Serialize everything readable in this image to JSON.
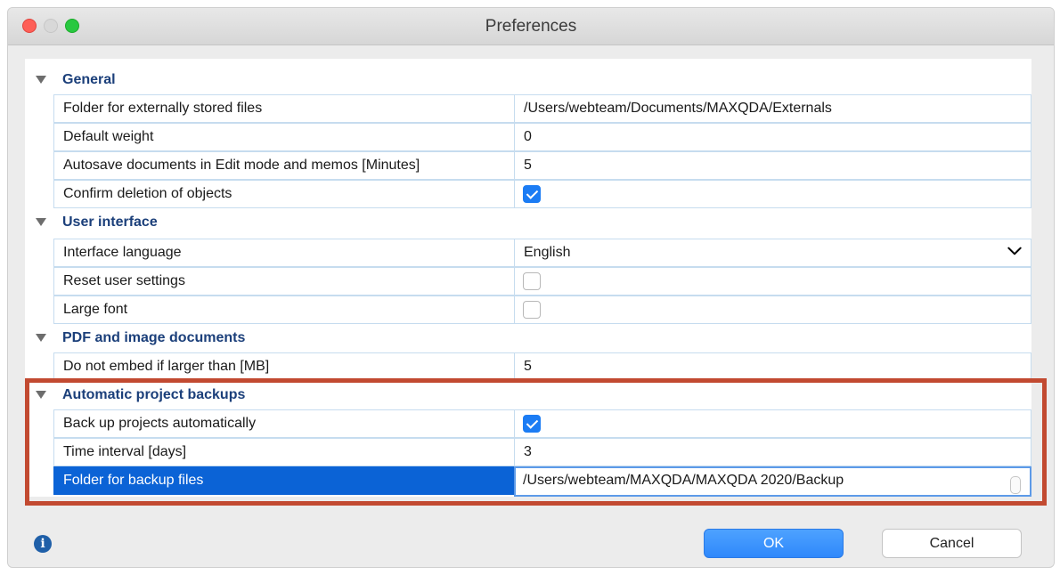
{
  "window": {
    "title": "Preferences"
  },
  "sections": {
    "general": {
      "label": "General",
      "rows": [
        {
          "label": "Folder for externally stored files",
          "value": "/Users/webteam/Documents/MAXQDA/Externals"
        },
        {
          "label": "Default weight",
          "value": "0"
        },
        {
          "label": "Autosave documents in Edit mode and memos [Minutes]",
          "value": "5"
        },
        {
          "label": "Confirm deletion of objects",
          "checked": true
        }
      ]
    },
    "ui": {
      "label": "User interface",
      "rows": [
        {
          "label": "Interface language",
          "value": "English"
        },
        {
          "label": "Reset user settings",
          "checked": false
        },
        {
          "label": "Large font",
          "checked": false
        }
      ]
    },
    "pdf": {
      "label": "PDF and image documents",
      "rows": [
        {
          "label": "Do not embed if larger than [MB]",
          "value": "5"
        }
      ]
    },
    "backup": {
      "label": "Automatic project backups",
      "rows": [
        {
          "label": "Back up projects automatically",
          "checked": true
        },
        {
          "label": "Time interval [days]",
          "value": "3"
        },
        {
          "label": "Folder for backup files",
          "value": "/Users/webteam/MAXQDA/MAXQDA 2020/Backup"
        }
      ]
    }
  },
  "buttons": {
    "ok": "OK",
    "cancel": "Cancel"
  },
  "colors": {
    "accent": "#1b7cf4",
    "highlight": "#c24a31",
    "section_text": "#1b3f7a",
    "selection": "#0b63d6"
  }
}
